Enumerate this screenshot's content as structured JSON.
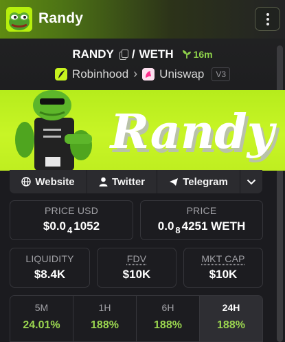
{
  "header": {
    "title": "Randy",
    "logo_icon": "pepe-frog-icon",
    "menu_icon": "vertical-dots-icon"
  },
  "pair": {
    "base": "RANDY",
    "separator": "/",
    "quote": "WETH",
    "age": "16m",
    "chain": "Robinhood",
    "dex": "Uniswap",
    "version": "V3"
  },
  "banner": {
    "word": "Randy"
  },
  "links": {
    "website": "Website",
    "twitter": "Twitter",
    "telegram": "Telegram"
  },
  "stats": {
    "price_usd": {
      "label": "PRICE USD",
      "prefix": "$0.0",
      "sub": "4",
      "suffix": "1052"
    },
    "price": {
      "label": "PRICE",
      "prefix": "0.0",
      "sub": "8",
      "suffix": "4251 WETH"
    },
    "liquidity": {
      "label": "LIQUIDITY",
      "value": "$8.4K"
    },
    "fdv": {
      "label": "FDV",
      "value": "$10K"
    },
    "mkt_cap": {
      "label": "MKT CAP",
      "value": "$10K"
    }
  },
  "timeframes": [
    {
      "label": "5M",
      "value": "24.01%"
    },
    {
      "label": "1H",
      "value": "188%"
    },
    {
      "label": "6H",
      "value": "188%"
    },
    {
      "label": "24H",
      "value": "188%"
    }
  ],
  "colors": {
    "accent_green": "#9bd64f",
    "banner_lime": "#c8f526",
    "age_green": "#8fd34b"
  }
}
